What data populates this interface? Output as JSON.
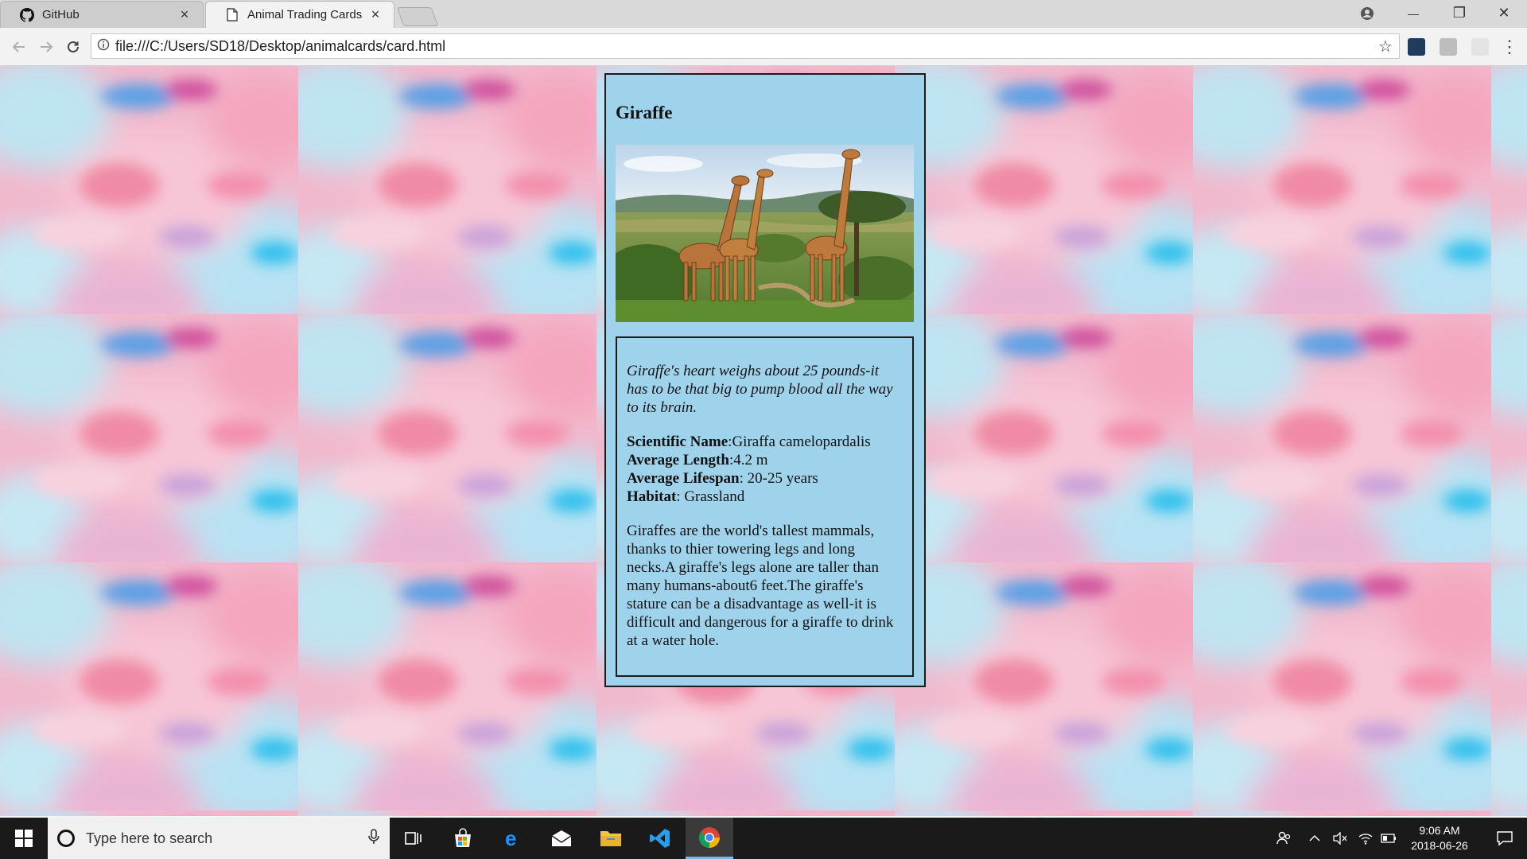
{
  "browser": {
    "tabs": [
      {
        "label": "GitHub",
        "icon": "github-icon",
        "close": "×"
      },
      {
        "label": "Animal Trading Cards",
        "icon": "page-icon",
        "close": "×"
      }
    ],
    "address": "file:///C:/Users/SD18/Desktop/animalcards/card.html",
    "window_controls": {
      "minimize": "—",
      "maximize": "❐",
      "close": "✕"
    }
  },
  "card": {
    "title": "Giraffe",
    "image_alt": "giraffes-photo",
    "fact": "Giraffe's heart weighs about 25 pounds-it has to be that big to pump blood all the way to its brain.",
    "stats": [
      {
        "label": "Scientific Name",
        "sep": ":",
        "value": "Giraffa camelopardalis"
      },
      {
        "label": "Average Length",
        "sep": ":",
        "value": "4.2 m"
      },
      {
        "label": "Average Lifespan",
        "sep": ": ",
        "value": "20-25 years"
      },
      {
        "label": "Habitat",
        "sep": ": ",
        "value": "Grassland"
      }
    ],
    "description": "Giraffes are the world's tallest mammals, thanks to thier towering legs and long necks.A giraffe's legs alone are taller than many humans-about6 feet.The giraffe's stature can be a disadvantage as well-it is difficult and dangerous for a giraffe to drink at a water hole."
  },
  "taskbar": {
    "search_placeholder": "Type here to search",
    "time": "9:06 AM",
    "date": "2018-06-26"
  },
  "colors": {
    "card_bg": "#9fd3ec",
    "taskbar_bg": "#1a1a1a"
  }
}
